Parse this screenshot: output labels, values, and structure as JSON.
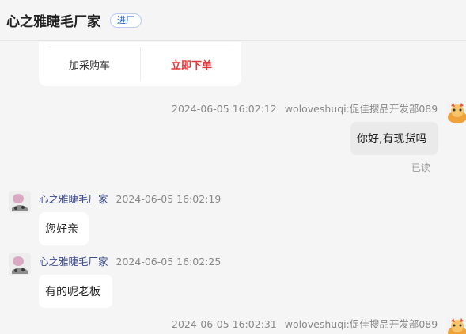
{
  "header": {
    "shop_name": "心之雅睫毛厂家",
    "enter_label": "进厂"
  },
  "product_card": {
    "add_cart_label": "加采购车",
    "buy_now_label": "立即下单"
  },
  "messages": [
    {
      "time": "2024-06-05 16:02:12",
      "sender": "woloveshuqi:促佳搜品开发部089",
      "text": "你好,有现货吗",
      "status": "已读"
    },
    {
      "sender": "心之雅睫毛厂家",
      "time": "2024-06-05 16:02:19",
      "text": "您好亲"
    },
    {
      "sender": "心之雅睫毛厂家",
      "time": "2024-06-05 16:02:25",
      "text": "有的呢老板"
    },
    {
      "time": "2024-06-05 16:02:31",
      "sender": "woloveshuqi:促佳搜品开发部089"
    }
  ],
  "colors": {
    "accent_red": "#e4393c",
    "seller_name": "#3b4a8f",
    "badge_blue": "#1a5ec8"
  }
}
